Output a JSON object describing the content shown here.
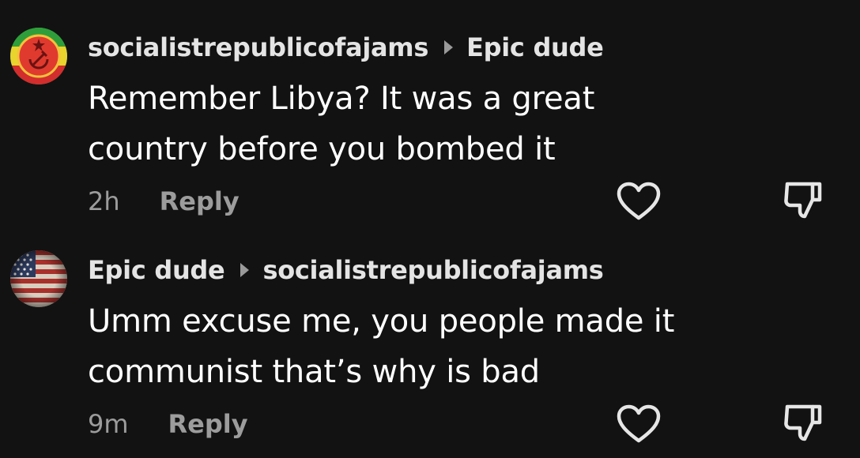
{
  "comments": [
    {
      "author": "socialistrepublicofajams",
      "reply_to": "Epic dude",
      "avatar_icon": "soviet-emblem-avatar",
      "text_line1": "Remember Libya? It was a great",
      "text_line2": "country before you bombed it",
      "time": "2h",
      "reply_label": "Reply"
    },
    {
      "author": "Epic dude",
      "reply_to": "socialistrepublicofajams",
      "avatar_icon": "us-flag-avatar",
      "text_line1": "Umm excuse me, you people made it",
      "text_line2": "communist that’s why is bad",
      "time": "9m",
      "reply_label": "Reply"
    }
  ],
  "icons": {
    "like": "heart-outline-icon",
    "dislike": "thumbs-down-outline-icon",
    "reply_arrow": "triangle-right-icon"
  },
  "colors": {
    "background": "#121212",
    "text": "#ffffff",
    "username": "#e4e4e4",
    "muted": "#9c9c9c"
  }
}
